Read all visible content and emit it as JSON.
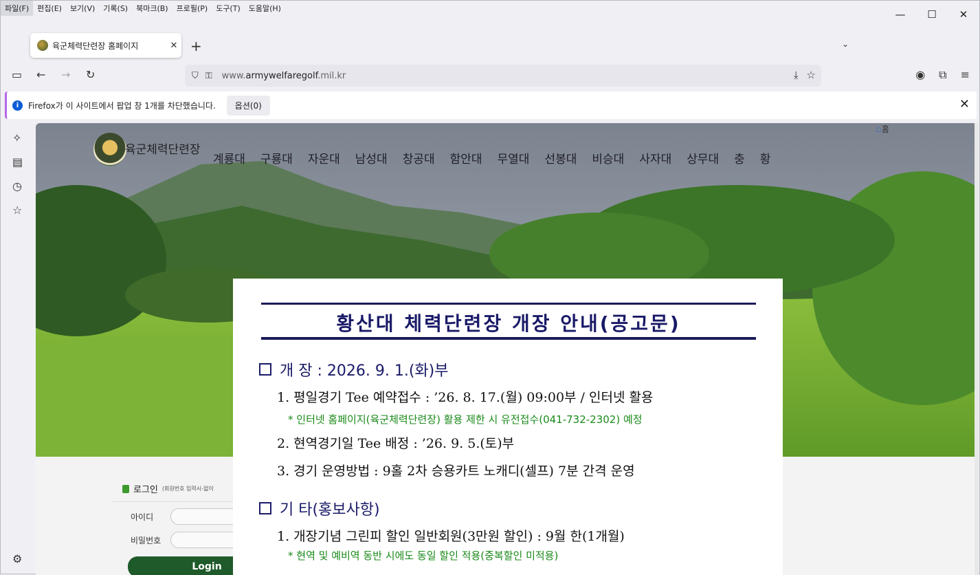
{
  "menubar": {
    "items": [
      "파일(F)",
      "편집(E)",
      "보기(V)",
      "기록(S)",
      "북마크(B)",
      "프로필(P)",
      "도구(T)",
      "도움말(H)"
    ]
  },
  "window_controls": {
    "minimize": "—",
    "maximize": "☐",
    "close": "✕"
  },
  "tab": {
    "title": "육군체력단련장 홈페이지",
    "close": "✕",
    "new_tab": "+",
    "list": "⌄"
  },
  "navbar": {
    "url_host_prefix": "www.",
    "url_host_main": "armywelfaregolf",
    "url_host_suffix": ".mil.kr"
  },
  "notification": {
    "message": "Firefox가 이 사이트에서 팝업 창 1개를 차단했습니다.",
    "options_button": "옵션(0)",
    "close": "✕"
  },
  "site": {
    "logo_text": "육군체력단련장",
    "home_link": "홈",
    "nav": [
      "계룡대",
      "구룡대",
      "자운대",
      "남성대",
      "창공대",
      "함안대",
      "무열대",
      "선봉대",
      "비승대",
      "사자대",
      "상무대",
      "충",
      "황"
    ],
    "login": {
      "title": "로그인",
      "hint": "(회원번호 입력시-없이",
      "id_label": "아이디",
      "pw_label": "비밀번호",
      "button": "Login"
    }
  },
  "popup": {
    "title": "황산대 체력단련장 개장 안내(공고문)",
    "section1": "개 장 : 2026. 9. 1.(화)부",
    "item1": "1. 평일경기 Tee 예약접수 : ’26. 8. 17.(월) 09:00부 / 인터넷 활용",
    "note1": "* 인터넷 홈페이지(육군체력단련장) 활용 제한 시 유전접수(041-732-2302) 예정",
    "item2": "2. 현역경기일 Tee 배정 : ’26. 9. 5.(토)부",
    "item3": "3. 경기 운영방법 : 9홀 2차 승용카트 노캐디(셀프) 7분 간격 운영",
    "section2": "기 타(홍보사항)",
    "item4": "1. 개장기념 그린피 할인 일반회원(3만원 할인) : 9월 한(1개월)",
    "note2": "* 현역 및 예비역 동반 시에도 동일 할인 적용(중복할인 미적용)"
  },
  "colors": {
    "popup_title": "#1a1a68",
    "popup_note": "#1a8a1a",
    "login_button": "#1f5a2a",
    "notif_accent": "#b565e8"
  }
}
